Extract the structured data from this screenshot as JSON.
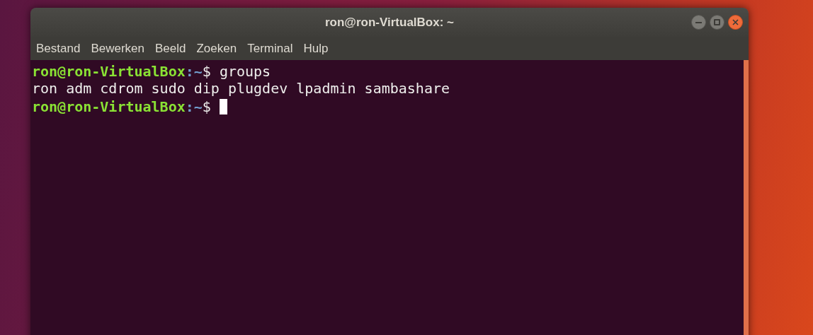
{
  "window": {
    "title": "ron@ron-VirtualBox: ~"
  },
  "menu": [
    "Bestand",
    "Bewerken",
    "Beeld",
    "Zoeken",
    "Terminal",
    "Hulp"
  ],
  "terminal": {
    "lines": [
      {
        "kind": "prompt",
        "user_host": "ron@ron-VirtualBox",
        "path": ":~",
        "symbol": "$",
        "command": "groups"
      },
      {
        "kind": "output",
        "text": "ron adm cdrom sudo dip plugdev lpadmin sambashare"
      },
      {
        "kind": "prompt",
        "user_host": "ron@ron-VirtualBox",
        "path": ":~",
        "symbol": "$",
        "cursor": true
      }
    ]
  }
}
